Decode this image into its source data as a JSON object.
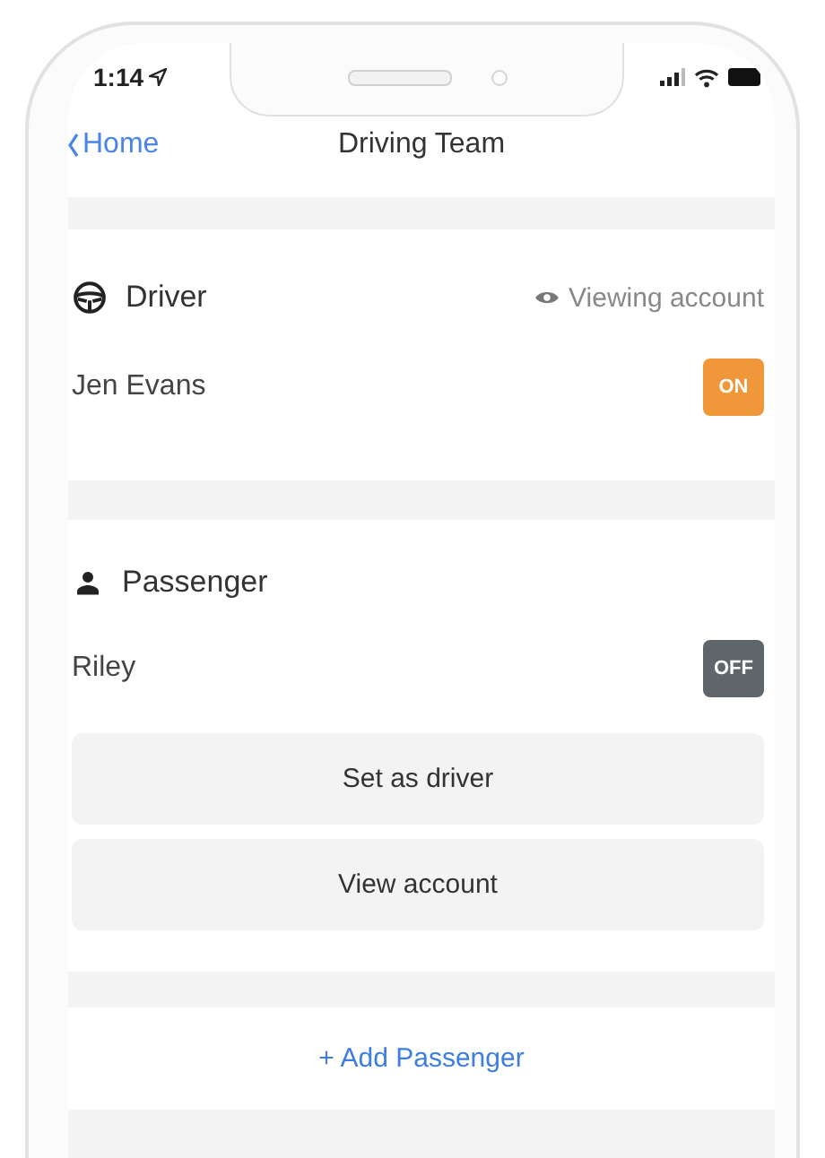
{
  "status_bar": {
    "time": "1:14"
  },
  "nav": {
    "back_label": "Home",
    "title": "Driving Team"
  },
  "sections": [
    {
      "kind": "driver",
      "title": "Driver",
      "note": "Viewing account",
      "members": [
        {
          "name": "Jen Evans",
          "on": true,
          "toggle_label": "ON"
        }
      ]
    },
    {
      "kind": "passenger",
      "title": "Passenger",
      "members": [
        {
          "name": "Riley",
          "on": false,
          "toggle_label": "OFF"
        }
      ],
      "buttons": [
        "Set as driver",
        "View account"
      ]
    }
  ],
  "add_button": {
    "label": "+ Add Passenger"
  }
}
